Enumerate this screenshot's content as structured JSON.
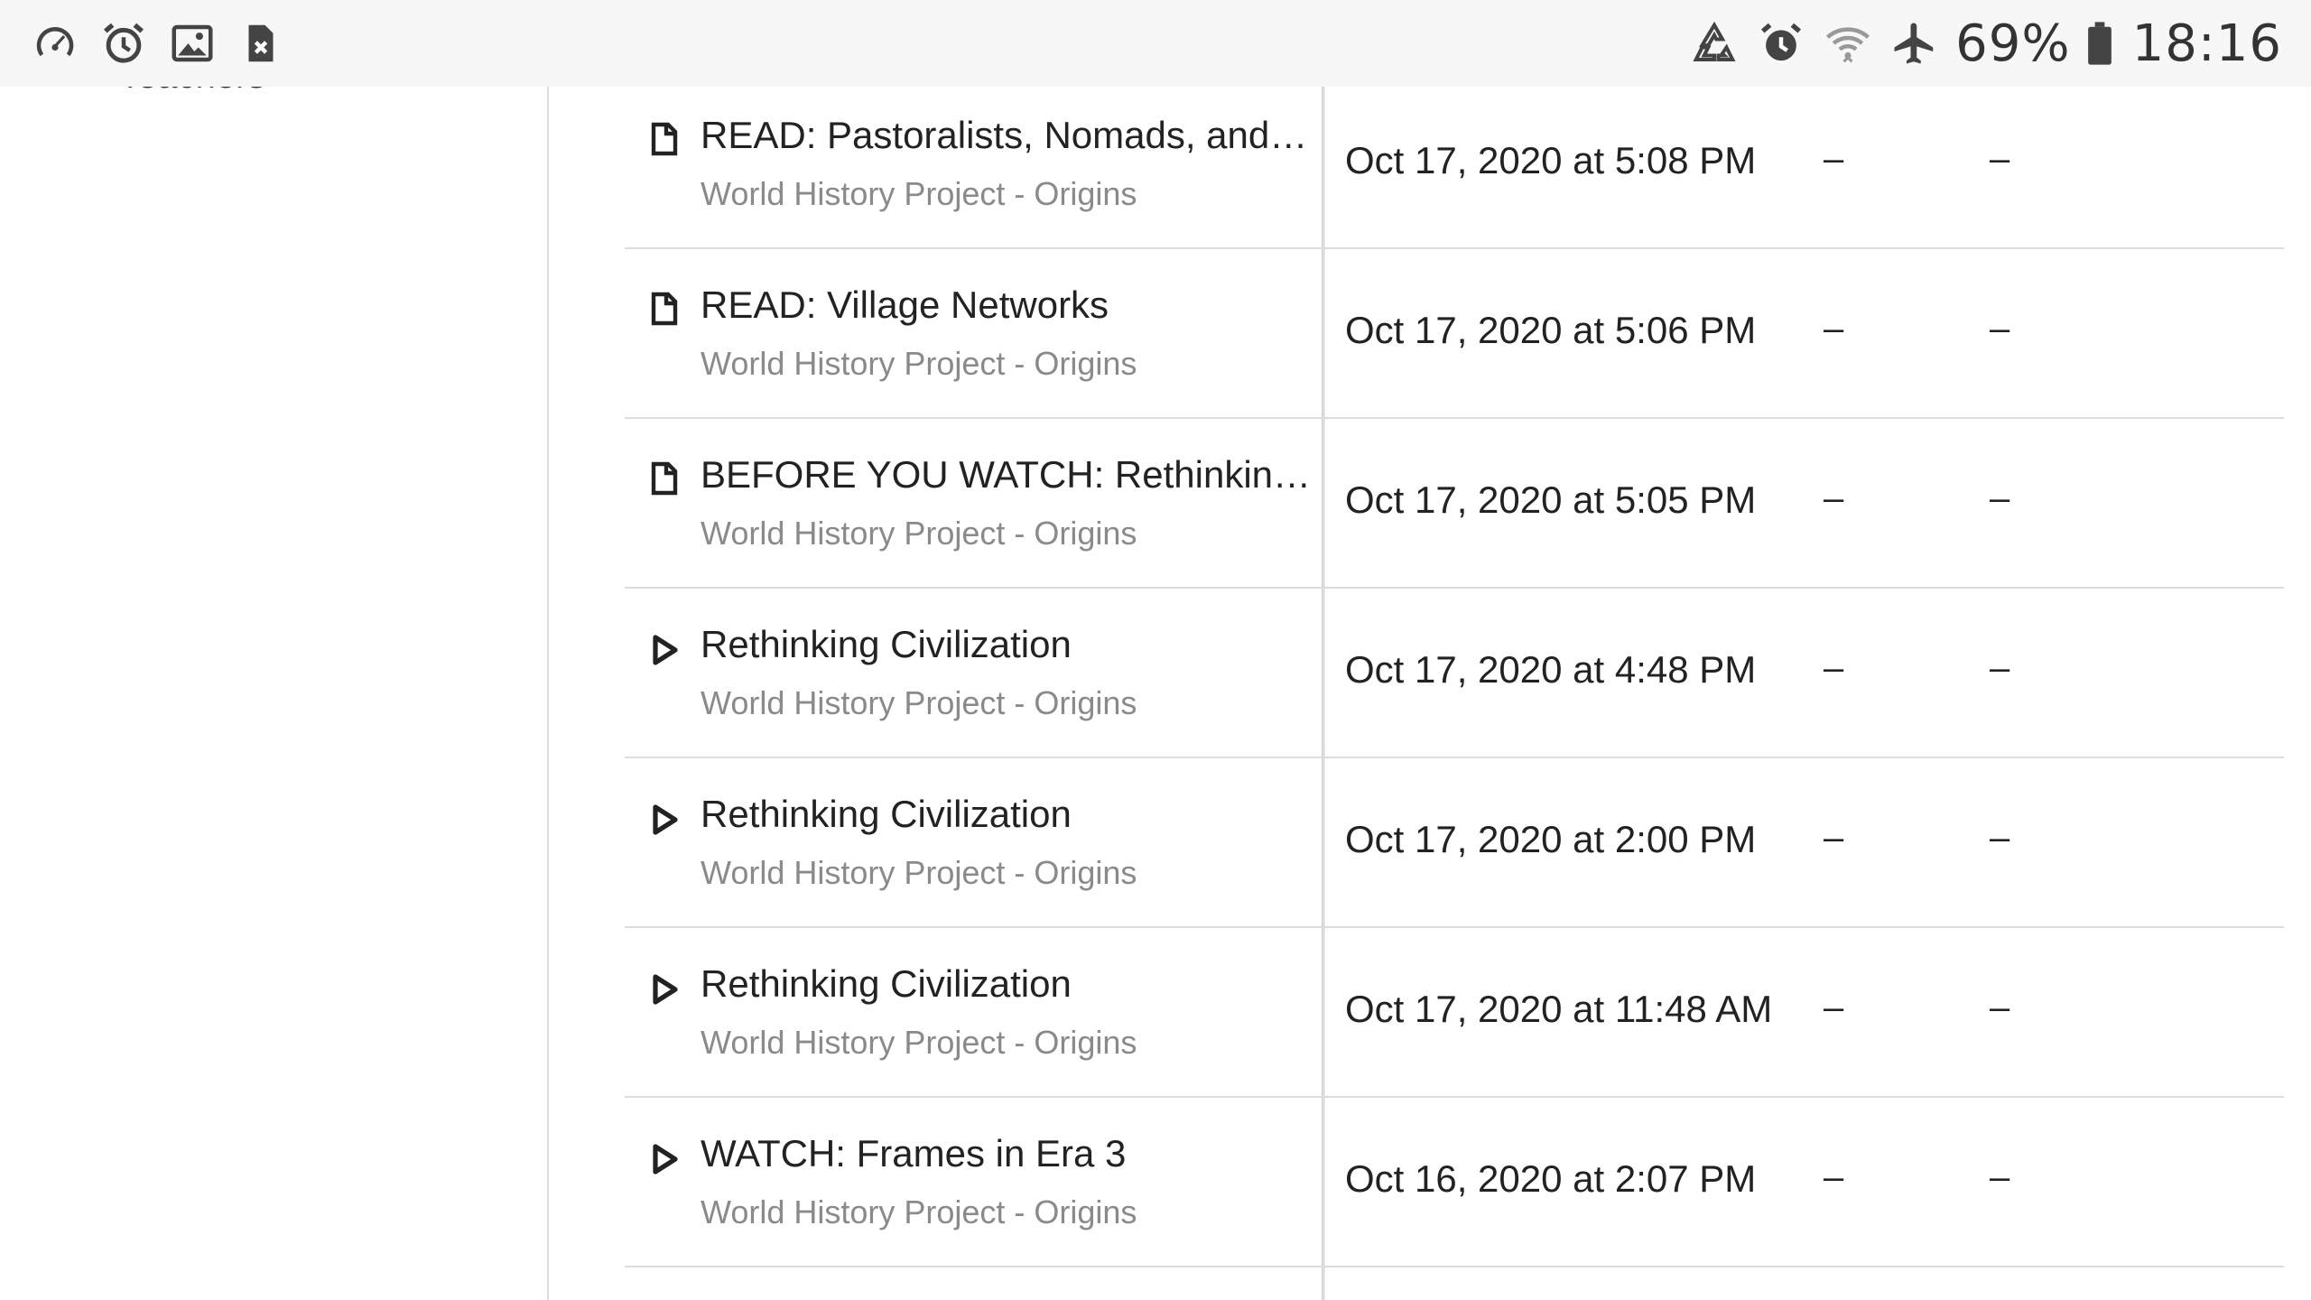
{
  "status_bar": {
    "left_icons": [
      "speedometer-icon",
      "alarm-icon",
      "image-icon",
      "file-close-icon"
    ],
    "right_icons": [
      "recycle-sync-icon",
      "alarm-icon",
      "wifi-icon",
      "airplane-icon",
      "battery-icon"
    ],
    "battery_percent": "69%",
    "time": "18:16"
  },
  "sidebar": {
    "cutoff_text": "Teachers"
  },
  "activities": [
    {
      "type": "article",
      "icon": "document-icon",
      "title": "READ: Pastoralists, Nomads, and F...",
      "course": "World History Project - Origins",
      "date": "Oct 17, 2020 at 5:08 PM",
      "col3": "–",
      "col4": "–"
    },
    {
      "type": "article",
      "icon": "document-icon",
      "title": "READ: Village Networks",
      "course": "World History Project - Origins",
      "date": "Oct 17, 2020 at 5:06 PM",
      "col3": "–",
      "col4": "–"
    },
    {
      "type": "article",
      "icon": "document-icon",
      "title": "BEFORE YOU WATCH: Rethinking...",
      "course": "World History Project - Origins",
      "date": "Oct 17, 2020 at 5:05 PM",
      "col3": "–",
      "col4": "–"
    },
    {
      "type": "video",
      "icon": "play-icon",
      "title": "Rethinking Civilization",
      "course": "World History Project - Origins",
      "date": "Oct 17, 2020 at 4:48 PM",
      "col3": "–",
      "col4": "–"
    },
    {
      "type": "video",
      "icon": "play-icon",
      "title": "Rethinking Civilization",
      "course": "World History Project - Origins",
      "date": "Oct 17, 2020 at 2:00 PM",
      "col3": "–",
      "col4": "–"
    },
    {
      "type": "video",
      "icon": "play-icon",
      "title": "Rethinking Civilization",
      "course": "World History Project - Origins",
      "date": "Oct 17, 2020 at 11:48 AM",
      "col3": "–",
      "col4": "–"
    },
    {
      "type": "video",
      "icon": "play-icon",
      "title": "WATCH: Frames in Era 3",
      "course": "World History Project - Origins",
      "date": "Oct 16, 2020 at 2:07 PM",
      "col3": "–",
      "col4": "–"
    }
  ]
}
